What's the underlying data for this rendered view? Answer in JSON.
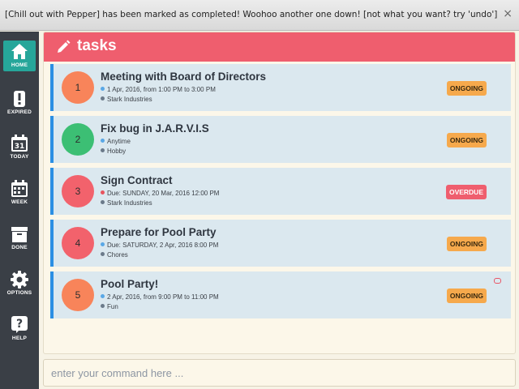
{
  "notification": {
    "message": "[Chill out with Pepper] has been marked as completed! Woohoo another one down! [not what you want? try 'undo']",
    "close": "×"
  },
  "sidebar": {
    "items": [
      {
        "label": "HOME",
        "icon": "home-icon",
        "active": true
      },
      {
        "label": "EXPIRED",
        "icon": "exclamation-icon"
      },
      {
        "label": "TODAY",
        "icon": "calendar-day-icon",
        "day": "31"
      },
      {
        "label": "WEEK",
        "icon": "calendar-week-icon"
      },
      {
        "label": "DONE",
        "icon": "archive-box-icon"
      },
      {
        "label": "OPTIONS",
        "icon": "gear-icon"
      },
      {
        "label": "HELP",
        "icon": "question-icon"
      }
    ]
  },
  "header": {
    "title": "tasks",
    "icon": "pencil-icon"
  },
  "tasks": [
    {
      "num": "1",
      "title": "Meeting with Board of Directors",
      "detail": "1 Apr, 2016, from 1:00 PM to 3:00 PM",
      "tag": "Stark Industries",
      "status": "ONGOING"
    },
    {
      "num": "2",
      "title": "Fix bug in J.A.R.V.I.S",
      "detail": "Anytime",
      "tag": "Hobby",
      "status": "ONGOING"
    },
    {
      "num": "3",
      "title": "Sign Contract",
      "detail": "Due: SUNDAY, 20 Mar, 2016 12:00 PM",
      "tag": "Stark Industries",
      "status": "OVERDUE"
    },
    {
      "num": "4",
      "title": "Prepare for Pool Party",
      "detail": "Due: SATURDAY, 2 Apr, 2016 8:00 PM",
      "tag": "Chores",
      "status": "ONGOING"
    },
    {
      "num": "5",
      "title": "Pool Party!",
      "detail": "2 Apr, 2016, from 9:00 PM to 11:00 PM",
      "tag": "Fun",
      "status": "ONGOING",
      "recurring_icon": "recurring-icon"
    }
  ],
  "command": {
    "placeholder": "enter your command here ..."
  },
  "colors": {
    "accent_teal": "#26a69a",
    "header_red": "#ef5e6e",
    "sidebar_bg": "#3a3f46",
    "card_bg": "#dbe8ef",
    "card_border": "#2b8fe3",
    "circle_orange": "#f8845a",
    "circle_green": "#3cbf74",
    "circle_red": "#f2626c",
    "badge_ongoing": "#f6a94c",
    "badge_overdue": "#ef5e6e",
    "dot_blue": "#5aa8e6",
    "dot_red": "#e8545e",
    "dot_gray": "#6b7a8a"
  }
}
